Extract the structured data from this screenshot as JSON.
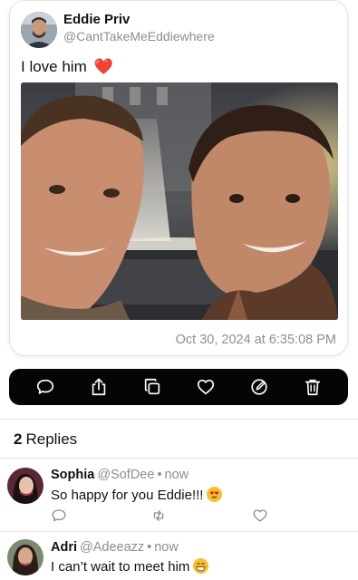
{
  "post": {
    "author_name": "Eddie Priv",
    "author_handle": "@CantTakeMeEddiewhere",
    "text": "I love him",
    "emoji": "❤️",
    "timestamp": "Oct 30, 2024 at 6:35:08 PM"
  },
  "actions": [
    {
      "name": "reply-button",
      "icon": "comment-icon"
    },
    {
      "name": "share-button",
      "icon": "share-icon"
    },
    {
      "name": "copy-button",
      "icon": "copy-icon"
    },
    {
      "name": "like-button",
      "icon": "heart-icon"
    },
    {
      "name": "edit-button",
      "icon": "edit-icon"
    },
    {
      "name": "delete-button",
      "icon": "trash-icon"
    }
  ],
  "replies_header": {
    "count": "2",
    "label": "Replies"
  },
  "replies": [
    {
      "name": "Sophia",
      "handle": "@SofDee",
      "dot": "•",
      "time": "now",
      "text": "So happy for you Eddie!!!",
      "emoji": "heart-eyes-emoji"
    },
    {
      "name": "Adri",
      "handle": "@Adeeazz",
      "dot": "•",
      "time": "now",
      "text": "I can’t wait to meet him",
      "emoji": "grin-emoji"
    }
  ],
  "colors": {
    "action_bar": "#050505",
    "muted_text": "#8e8e93",
    "heart": "#e0162b"
  }
}
